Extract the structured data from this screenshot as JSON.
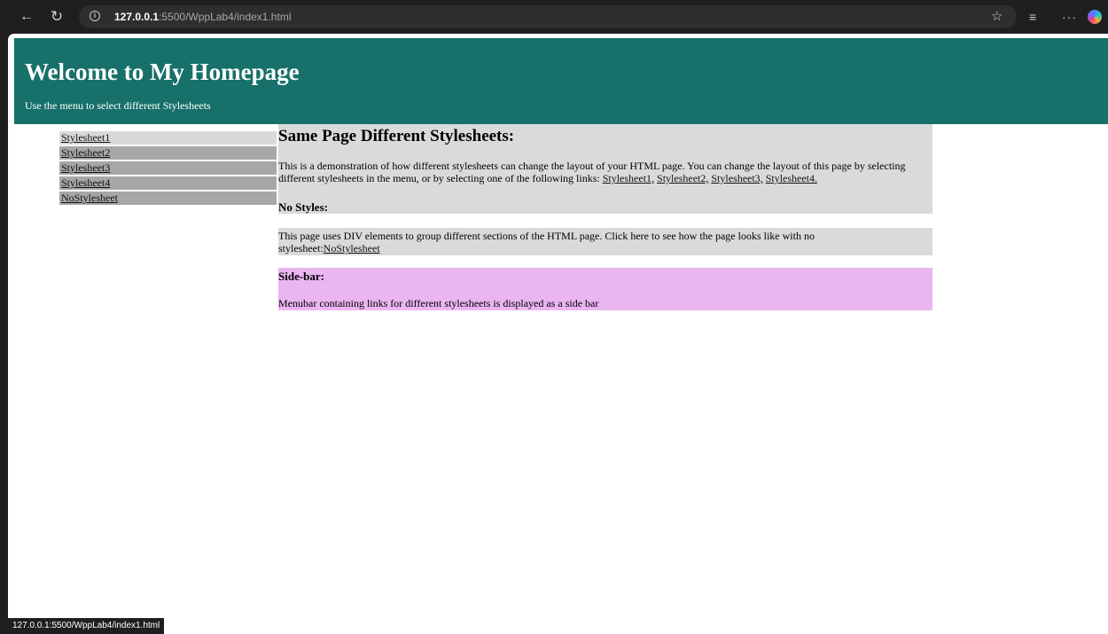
{
  "browser": {
    "url_host": "127.0.0.1",
    "url_rest": ":5500/WppLab4/index1.html",
    "icons": [
      "back-arrow-icon",
      "reload-icon",
      "info-icon",
      "star-icon",
      "favorites-icon",
      "more-icon",
      "copilot-icon"
    ],
    "status_url": "127.0.0.1:5500/WppLab4/index1.html"
  },
  "header": {
    "title": "Welcome to My Homepage",
    "subtitle": "Use the menu to select different Stylesheets"
  },
  "menu": [
    "Stylesheet1",
    "Stylesheet2",
    "Stylesheet3",
    "Stylesheet4",
    "NoStylesheet"
  ],
  "section1": {
    "heading": "Same Page Different Stylesheets:",
    "text": "This is a demonstration of how different stylesheets can change the layout of your HTML page. You can change the layout of this page by selecting different stylesheets in the menu, or by selecting one of the following links: ",
    "links": [
      "Stylesheet1,",
      "Stylesheet2,",
      "Stylesheet3,",
      "Stylesheet4."
    ],
    "subheading": "No Styles:"
  },
  "section2": {
    "text": "This page uses DIV elements to group different sections of the HTML page. Click here to see how the page looks like with no stylesheet:",
    "link": "NoStylesheet"
  },
  "section3": {
    "heading": "Side-bar:",
    "text": "Menubar containing links for different stylesheets is displayed as a side bar"
  },
  "colors": {
    "header_bg": "#17706a",
    "content_bg": "#d9dadb",
    "sidebar_section_bg": "#ebb5f2",
    "menu_active_bg": "#d9d9d9",
    "menu_bg": "#a7a7a7"
  }
}
